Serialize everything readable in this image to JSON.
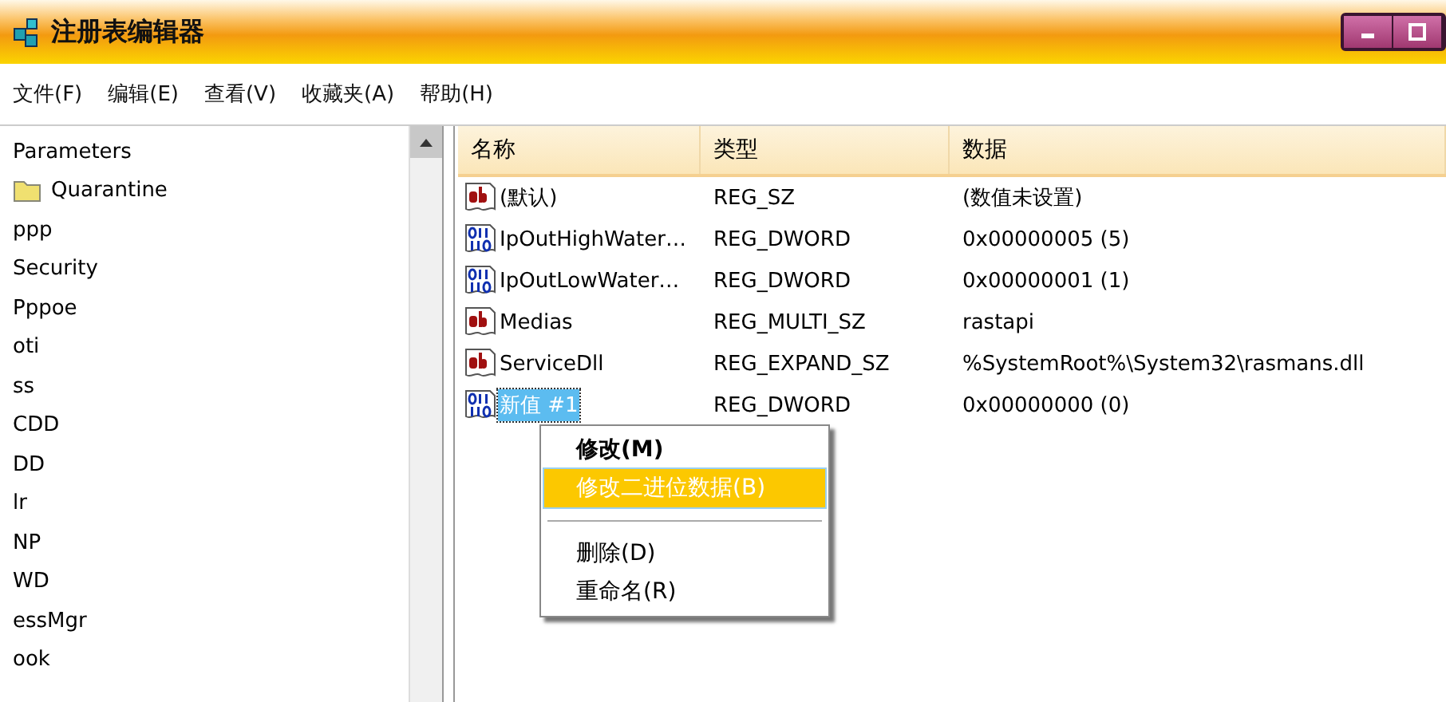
{
  "window": {
    "title": "注册表编辑器"
  },
  "menu": [
    "文件(F)",
    "编辑(E)",
    "查看(V)",
    "收藏夹(A)",
    "帮助(H)"
  ],
  "tree": [
    {
      "label": "Parameters",
      "kind": "text"
    },
    {
      "label": "Quarantine",
      "kind": "folder"
    },
    {
      "label": "ppp",
      "kind": "text"
    },
    {
      "label": "Security",
      "kind": "text"
    },
    {
      "label": "Pppoe",
      "kind": "text"
    },
    {
      "label": "oti",
      "kind": "text"
    },
    {
      "label": "ss",
      "kind": "text"
    },
    {
      "label": "CDD",
      "kind": "text"
    },
    {
      "label": "DD",
      "kind": "text"
    },
    {
      "label": "lr",
      "kind": "text"
    },
    {
      "label": "NP",
      "kind": "text"
    },
    {
      "label": "WD",
      "kind": "text"
    },
    {
      "label": "essMgr",
      "kind": "text"
    },
    {
      "label": "ook",
      "kind": "text"
    }
  ],
  "table": {
    "columns": [
      "名称",
      "类型",
      "数据"
    ],
    "rows": [
      {
        "kind": "string",
        "name": "(默认)",
        "type": "REG_SZ",
        "data": "(数值未设置)",
        "selected": false
      },
      {
        "kind": "binary",
        "name": "IpOutHighWater…",
        "type": "REG_DWORD",
        "data": "0x00000005 (5)",
        "selected": false
      },
      {
        "kind": "binary",
        "name": "IpOutLowWater…",
        "type": "REG_DWORD",
        "data": "0x00000001 (1)",
        "selected": false
      },
      {
        "kind": "string",
        "name": "Medias",
        "type": "REG_MULTI_SZ",
        "data": "rastapi",
        "selected": false
      },
      {
        "kind": "string",
        "name": "ServiceDll",
        "type": "REG_EXPAND_SZ",
        "data": "%SystemRoot%\\System32\\rasmans.dll",
        "selected": false
      },
      {
        "kind": "binary",
        "name": "新值 #1",
        "type": "REG_DWORD",
        "data": "0x00000000 (0)",
        "selected": true
      }
    ]
  },
  "context_menu": [
    {
      "kind": "item",
      "label": "修改(M)",
      "bold": true,
      "selected": false
    },
    {
      "kind": "item",
      "label": "修改二进位数据(B)",
      "bold": false,
      "selected": true
    },
    {
      "kind": "separator"
    },
    {
      "kind": "item",
      "label": "删除(D)",
      "bold": false,
      "selected": false
    },
    {
      "kind": "item",
      "label": "重命名(R)",
      "bold": false,
      "selected": false
    }
  ]
}
